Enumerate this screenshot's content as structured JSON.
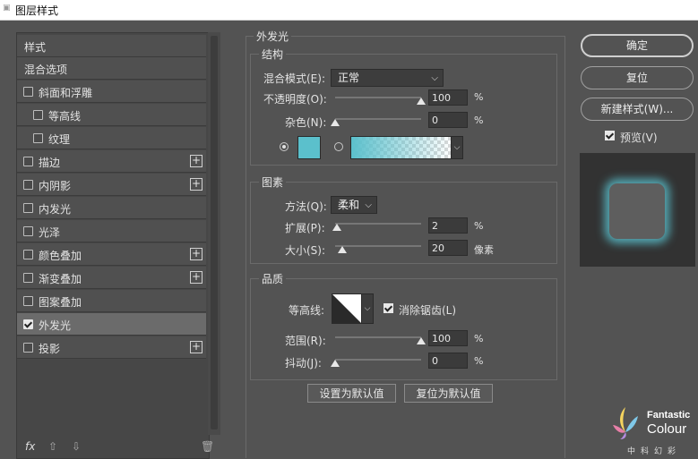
{
  "window": {
    "title": "图层样式"
  },
  "sidebar": {
    "items": [
      {
        "label": "样式"
      },
      {
        "label": "混合选项"
      },
      {
        "label": "斜面和浮雕"
      },
      {
        "label": "等高线"
      },
      {
        "label": "纹理"
      },
      {
        "label": "描边"
      },
      {
        "label": "内阴影"
      },
      {
        "label": "内发光"
      },
      {
        "label": "光泽"
      },
      {
        "label": "颜色叠加"
      },
      {
        "label": "渐变叠加"
      },
      {
        "label": "图案叠加"
      },
      {
        "label": "外发光"
      },
      {
        "label": "投影"
      }
    ],
    "checked_item": "外发光",
    "bottom": {
      "fx": "fx",
      "up": "⇧",
      "down": "⇩",
      "trash": "🗑"
    }
  },
  "panel": {
    "title": "外发光",
    "structure": {
      "label": "结构",
      "blend_mode_label": "混合模式(E):",
      "blend_mode_value": "正常",
      "opacity_label": "不透明度(O):",
      "opacity_value": "100",
      "opacity_unit": "%",
      "opacity_level": 1.0,
      "noise_label": "杂色(N):",
      "noise_value": "0",
      "noise_unit": "%",
      "noise_level": 0.0,
      "glow_color": "#5bc0cc"
    },
    "elements": {
      "label": "图素",
      "method_label": "方法(Q):",
      "method_value": "柔和",
      "spread_label": "扩展(P):",
      "spread_value": "2",
      "spread_unit": "%",
      "spread_level": 0.02,
      "size_label": "大小(S):",
      "size_value": "20",
      "size_unit": "像素",
      "size_level": 0.08
    },
    "quality": {
      "label": "品质",
      "contour_label": "等高线:",
      "antialias_label": "消除锯齿(L)",
      "antialias_checked": true,
      "range_label": "范围(R):",
      "range_value": "100",
      "range_unit": "%",
      "range_level": 1.0,
      "jitter_label": "抖动(J):",
      "jitter_value": "0",
      "jitter_unit": "%",
      "jitter_level": 0.0
    },
    "buttons": {
      "set_default": "设置为默认值",
      "reset_default": "复位为默认值"
    }
  },
  "actions": {
    "ok": "确定",
    "reset": "复位",
    "new_style": "新建样式(W)...",
    "preview_label": "预览(V)",
    "preview_checked": true
  },
  "watermark": {
    "line1": "Fantastic",
    "line2": "Colour",
    "line3": "中科幻彩"
  }
}
